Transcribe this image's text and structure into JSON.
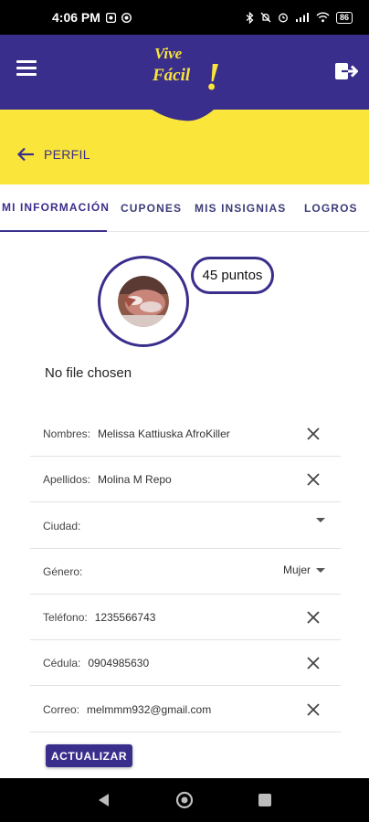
{
  "status_bar": {
    "time": "4:06 PM",
    "battery": "86"
  },
  "header": {
    "logo_line1": "Vive",
    "logo_line2": "Fácil",
    "logo_exclaim": "!",
    "colors": {
      "primary": "#3a2e8c",
      "accent": "#fae53b"
    }
  },
  "page": {
    "back_label": "PERFIL"
  },
  "tabs": [
    {
      "label": "MI INFORMACIÓN",
      "active": true
    },
    {
      "label": "CUPONES",
      "active": false
    },
    {
      "label": "MIS INSIGNIAS",
      "active": false
    },
    {
      "label": "LOGROS",
      "active": false
    }
  ],
  "profile": {
    "points": "45 puntos",
    "file_status": "No file chosen"
  },
  "form": {
    "nombres": {
      "label": "Nombres:",
      "value": "Melissa Kattiuska AfroKiller"
    },
    "apellidos": {
      "label": "Apellidos:",
      "value": "Molina M Repo"
    },
    "ciudad": {
      "label": "Ciudad:",
      "value": ""
    },
    "genero": {
      "label": "Género:",
      "value": "Mujer"
    },
    "telefono": {
      "label": "Teléfono:",
      "value": "1235566743"
    },
    "cedula": {
      "label": "Cédula:",
      "value": "0904985630"
    },
    "correo": {
      "label": "Correo:",
      "value": "melmmm932@gmail.com"
    }
  },
  "actions": {
    "update_label": "ACTUALIZAR"
  }
}
